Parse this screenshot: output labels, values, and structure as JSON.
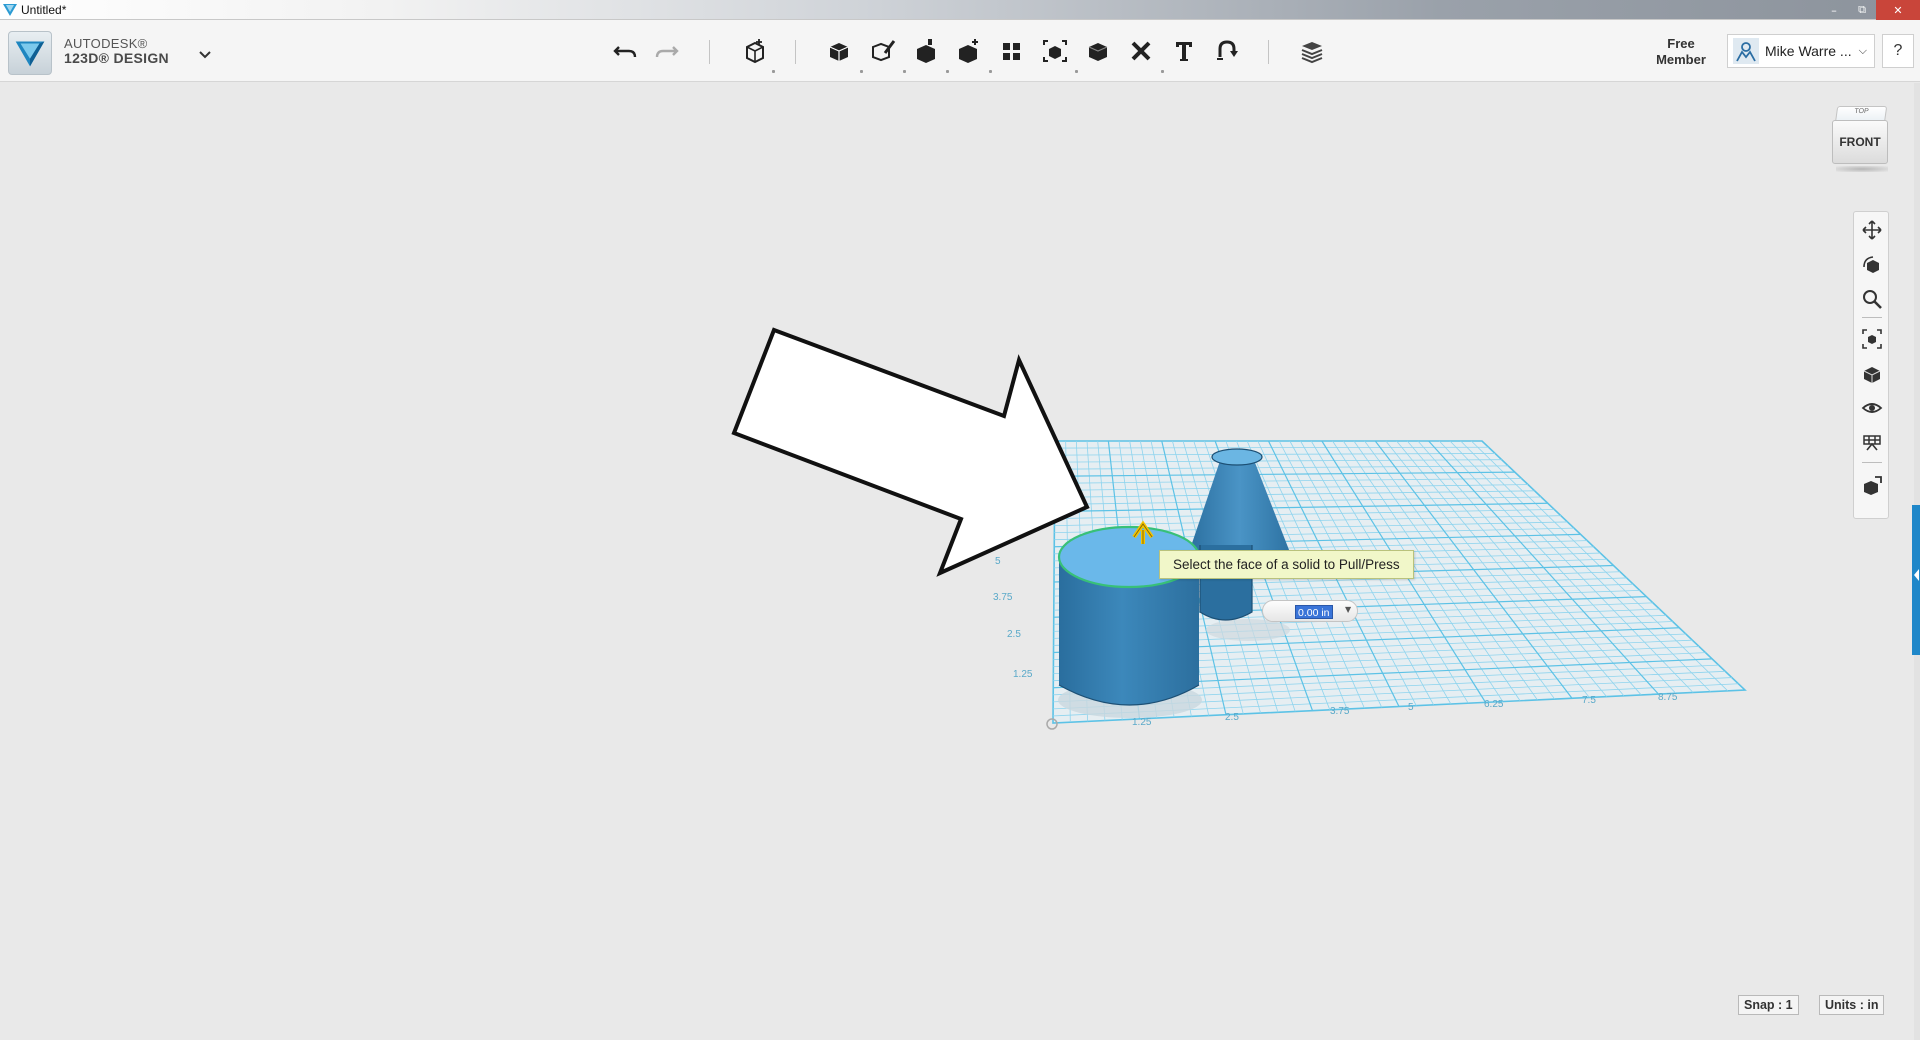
{
  "window": {
    "title": "Untitled*"
  },
  "brand": {
    "line1": "AUTODESK®",
    "line2": "123D® DESIGN"
  },
  "toolbar": {
    "undo": "undo-icon",
    "redo": "redo-icon",
    "primitives": "primitive-box-icon",
    "tools": [
      "sketch-box-icon",
      "sketch-pen-icon",
      "construct-icon",
      "modify-icon",
      "pattern-icon",
      "group-icon",
      "combine-icon",
      "delete-icon",
      "text-icon",
      "snap-icon",
      "layers-icon"
    ]
  },
  "account": {
    "membership": "Free\nMember",
    "membership_line1": "Free",
    "membership_line2": "Member",
    "user_name": "Mike Warre ...",
    "help": "?"
  },
  "viewcube": {
    "top_label": "TOP",
    "face_label": "FRONT"
  },
  "navigation": [
    "pan-icon",
    "orbit-icon",
    "zoom-icon",
    "fit-icon",
    "views-icon",
    "visibility-icon",
    "material-icon",
    "tools-icon"
  ],
  "tooltip": {
    "text": "Select the face of a solid to Pull/Press"
  },
  "dimension": {
    "value": "0.00 in"
  },
  "grid_labels": {
    "y": [
      "5",
      "3.75",
      "2.5",
      "1.25"
    ],
    "x": [
      "1.25",
      "2.5",
      "3.75",
      "5",
      "6.25",
      "7.5",
      "8.75"
    ]
  },
  "status": {
    "snap": "Snap : 1",
    "units": "Units : in"
  },
  "colors": {
    "accent": "#1f87c9",
    "solid": "#3a8ac0",
    "grid": "#5cc2e6",
    "tooltip_bg": "#f1f7c9"
  }
}
